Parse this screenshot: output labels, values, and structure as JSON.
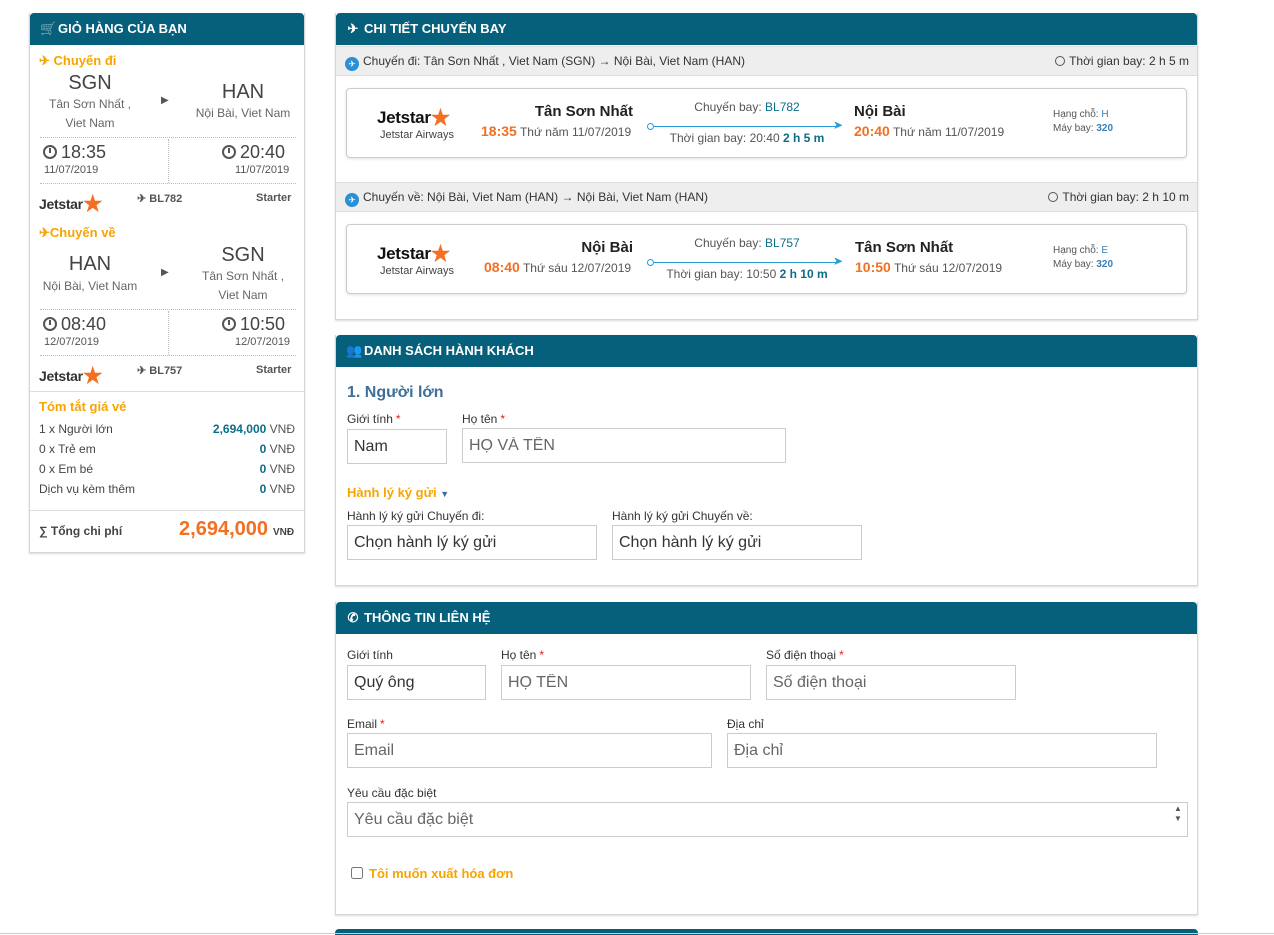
{
  "cart": {
    "title": "GIỎ HÀNG CỦA BẠN",
    "outbound": {
      "label": "Chuyến đi",
      "from_code": "SGN",
      "from_name_1": "Tân Sơn Nhất ,",
      "from_name_2": "Viet Nam",
      "to_code": "HAN",
      "to_name": "Nội Bài, Viet Nam",
      "dep_time": "18:35",
      "dep_date": "11/07/2019",
      "arr_time": "20:40",
      "arr_date": "11/07/2019",
      "airline_logo": "Jetstar",
      "flight_no": "BL782",
      "fare": "Starter"
    },
    "return": {
      "label": "Chuyến về",
      "from_code": "HAN",
      "from_name": "Nội Bài, Viet Nam",
      "to_code": "SGN",
      "to_name_1": "Tân Sơn Nhất ,",
      "to_name_2": "Viet Nam",
      "dep_time": "08:40",
      "dep_date": "12/07/2019",
      "arr_time": "10:50",
      "arr_date": "12/07/2019",
      "airline_logo": "Jetstar",
      "flight_no": "BL757",
      "fare": "Starter"
    },
    "summary": {
      "title": "Tóm tắt giá vé",
      "rows": [
        {
          "label": "1 x Người lớn",
          "amount": "2,694,000",
          "currency": "VNĐ"
        },
        {
          "label": "0 x Trẻ em",
          "amount": "0",
          "currency": "VNĐ"
        },
        {
          "label": "0 x Em bé",
          "amount": "0",
          "currency": "VNĐ"
        },
        {
          "label": "Dịch vụ kèm thêm",
          "amount": "0",
          "currency": "VNĐ"
        }
      ],
      "total_label": "∑ Tổng chi phí",
      "total_amount": "2,694,000",
      "total_currency": "VNĐ"
    }
  },
  "flight_detail": {
    "title": "CHI TIẾT CHUYẾN BAY",
    "outbound": {
      "header": "Chuyến đi: Tân Sơn Nhất , Viet Nam (SGN) → Nội Bài, Viet Nam (HAN)",
      "duration_header": "Thời gian bay: 2 h 5 m",
      "airline": "Jetstar",
      "airline_sub": "Jetstar Airways",
      "dep_city": "Tân Sơn Nhất",
      "dep_time": "18:35",
      "dep_date": "Thứ năm 11/07/2019",
      "flight_label": "Chuyến bay:",
      "flight_no": "BL782",
      "duration_label": "Thời gian bay: 20:40",
      "duration": "2 h 5 m",
      "arr_city": "Nội Bài",
      "arr_time": "20:40",
      "arr_date": "Thứ năm 11/07/2019",
      "class_label": "Hạng chỗ:",
      "class_value": "H",
      "aircraft_label": "Máy bay:",
      "aircraft_value": "320"
    },
    "return": {
      "header": "Chuyến về: Nội Bài, Viet Nam (HAN) → Nội Bài, Viet Nam (HAN)",
      "duration_header": "Thời gian bay: 2 h 10 m",
      "airline": "Jetstar",
      "airline_sub": "Jetstar Airways",
      "dep_city": "Nội Bài",
      "dep_time": "08:40",
      "dep_date": "Thứ sáu 12/07/2019",
      "flight_label": "Chuyến bay:",
      "flight_no": "BL757",
      "duration_label": "Thời gian bay: 10:50",
      "duration": "2 h 10 m",
      "arr_city": "Tân Sơn Nhất",
      "arr_time": "10:50",
      "arr_date": "Thứ sáu 12/07/2019",
      "class_label": "Hạng chỗ:",
      "class_value": "E",
      "aircraft_label": "Máy bay:",
      "aircraft_value": "320"
    }
  },
  "passengers": {
    "title": "DANH SÁCH HÀNH KHÁCH",
    "adult_title": "1. Người lớn",
    "gender_label": "Giới tính",
    "gender_value": "Nam",
    "name_label": "Họ tên",
    "name_placeholder": "HỌ VÀ TÊN",
    "baggage_title": "Hành lý ký gửi",
    "baggage_out_label": "Hành lý ký gửi Chuyến đi:",
    "baggage_out_value": "Chọn hành lý ký gửi",
    "baggage_ret_label": "Hành lý ký gửi Chuyến về:",
    "baggage_ret_value": "Chọn hành lý ký gửi"
  },
  "contact": {
    "title": "THÔNG TIN LIÊN HỆ",
    "gender_label": "Giới tính",
    "gender_value": "Quý ông",
    "name_label": "Họ tên",
    "name_placeholder": "HỌ TÊN",
    "phone_label": "Số điện thoại",
    "phone_placeholder": "Số điện thoại",
    "email_label": "Email",
    "email_placeholder": "Email",
    "address_label": "Địa chỉ",
    "address_placeholder": "Địa chỉ",
    "special_label": "Yêu cầu đặc biệt",
    "special_placeholder": "Yêu cầu đặc biệt",
    "invoice_label": "Tôi muốn xuất hóa đơn"
  }
}
